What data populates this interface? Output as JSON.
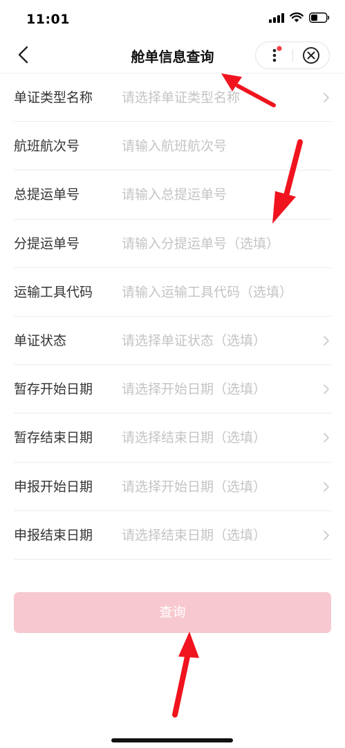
{
  "status_bar": {
    "time": "11:01",
    "icons": [
      "signal-icon",
      "wifi-icon",
      "battery-icon"
    ]
  },
  "nav": {
    "title": "舱单信息查询",
    "back_icon": "chevron-left-icon",
    "more_icon": "more-dots-icon",
    "close_icon": "close-circle-icon"
  },
  "form": {
    "rows": [
      {
        "label": "单证类型名称",
        "placeholder": "请选择单证类型名称",
        "has_chevron": true
      },
      {
        "label": "航班航次号",
        "placeholder": "请输入航班航次号",
        "has_chevron": false
      },
      {
        "label": "总提运单号",
        "placeholder": "请输入总提运单号",
        "has_chevron": false
      },
      {
        "label": "分提运单号",
        "placeholder": "请输入分提运单号（选填）",
        "has_chevron": false
      },
      {
        "label": "运输工具代码",
        "placeholder": "请输入运输工具代码（选填）",
        "has_chevron": false
      },
      {
        "label": "单证状态",
        "placeholder": "请选择单证状态（选填）",
        "has_chevron": true
      },
      {
        "label": "暂存开始日期",
        "placeholder": "请选择开始日期（选填）",
        "has_chevron": true
      },
      {
        "label": "暂存结束日期",
        "placeholder": "请选择结束日期（选填）",
        "has_chevron": true
      },
      {
        "label": "申报开始日期",
        "placeholder": "请选择开始日期（选填）",
        "has_chevron": true
      },
      {
        "label": "申报结束日期",
        "placeholder": "请选择结束日期（选填）",
        "has_chevron": true
      }
    ]
  },
  "submit": {
    "label": "查询"
  },
  "colors": {
    "accent_disabled": "#f7c8cf",
    "placeholder": "#c4c4c4",
    "annotation_arrow": "#f0141e",
    "notification_dot": "#f24040"
  }
}
